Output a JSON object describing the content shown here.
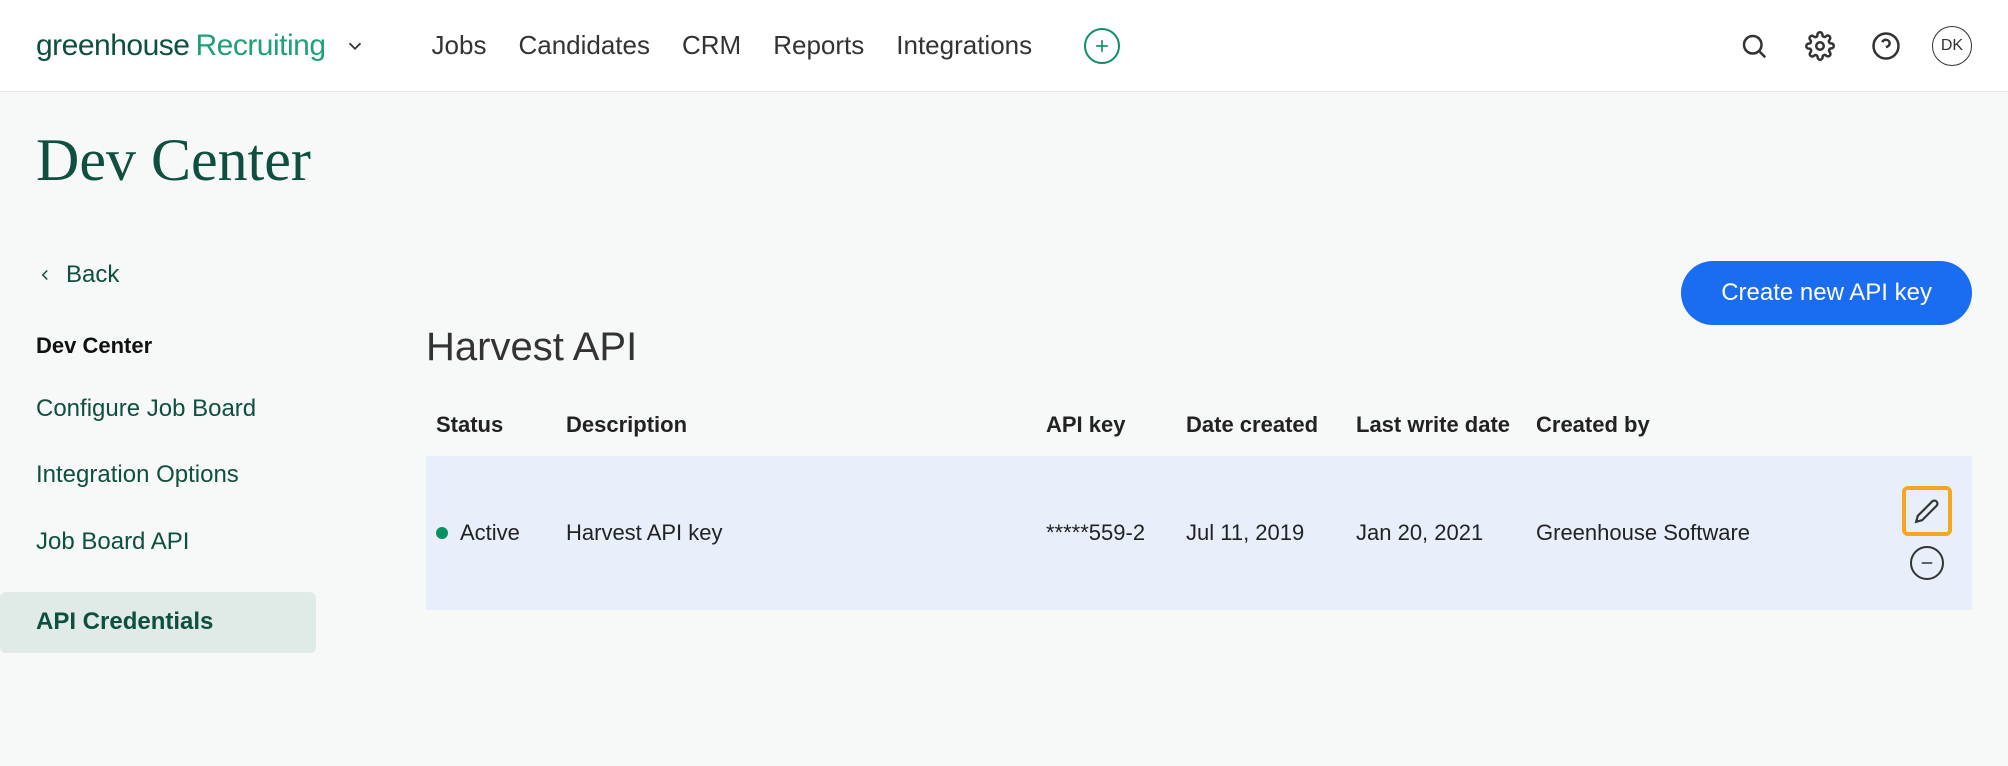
{
  "brand": {
    "part1": "greenhouse",
    "part2": "Recruiting"
  },
  "nav": {
    "items": [
      "Jobs",
      "Candidates",
      "CRM",
      "Reports",
      "Integrations"
    ]
  },
  "avatar_initials": "DK",
  "page_title": "Dev Center",
  "back_label": "Back",
  "sidebar": {
    "heading": "Dev Center",
    "items": [
      {
        "label": "Configure Job Board"
      },
      {
        "label": "Integration Options"
      },
      {
        "label": "Job Board API"
      },
      {
        "label": "API Credentials",
        "active": true
      }
    ]
  },
  "create_button_label": "Create new API key",
  "section_title": "Harvest API",
  "table": {
    "headers": {
      "status": "Status",
      "description": "Description",
      "api_key": "API key",
      "date_created": "Date created",
      "last_write": "Last write date",
      "created_by": "Created by"
    },
    "rows": [
      {
        "status": "Active",
        "description": "Harvest API key",
        "api_key": "*****559-2",
        "date_created": "Jul 11, 2019",
        "last_write": "Jan 20, 2021",
        "created_by": "Greenhouse Software"
      }
    ]
  }
}
